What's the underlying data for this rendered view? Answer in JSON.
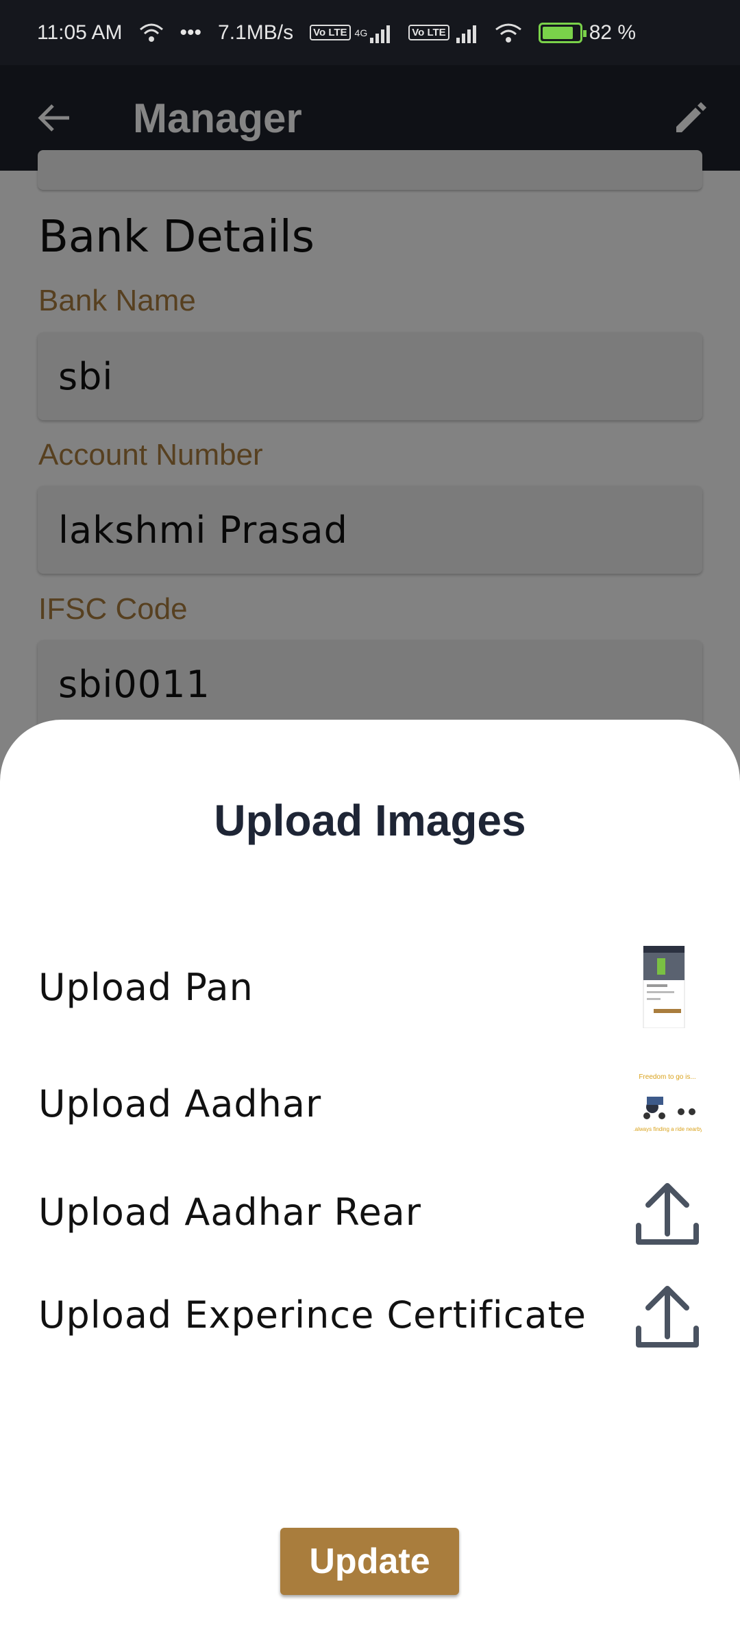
{
  "status_bar": {
    "time": "11:05 AM",
    "dots": "•••",
    "speed": "7.1MB/s",
    "volte1": "Vo LTE",
    "volte2": "Vo LTE",
    "network": "4G",
    "battery": "82 %"
  },
  "app_bar": {
    "title": "Manager",
    "back_icon": "arrow-back-icon",
    "edit_icon": "pencil-icon"
  },
  "bank": {
    "section_title": "Bank Details",
    "bank_name_label": "Bank Name",
    "bank_name_value": "sbi",
    "account_label": "Account Number",
    "account_value": "lakshmi Prasad",
    "ifsc_label": "IFSC Code",
    "ifsc_value": "sbi0011"
  },
  "sheet": {
    "title": "Upload Images",
    "items": [
      {
        "label": "Upload Pan",
        "status": "thumbnail"
      },
      {
        "label": "Upload Aadhar",
        "status": "thumbnail"
      },
      {
        "label": "Upload Aadhar Rear",
        "status": "upload-icon"
      },
      {
        "label": "Upload Experince Certificate",
        "status": "upload-icon"
      }
    ],
    "thumb_aadhar_caption_top": "Freedom to go is...",
    "thumb_aadhar_caption_bottom": "...always finding a ride nearby!",
    "update_label": "Update"
  },
  "colors": {
    "accent": "#a97d3d",
    "app_bar": "#1e222b",
    "status_bar": "#15171d",
    "label": "#a87b3e",
    "sheet_title": "#1e2535"
  }
}
